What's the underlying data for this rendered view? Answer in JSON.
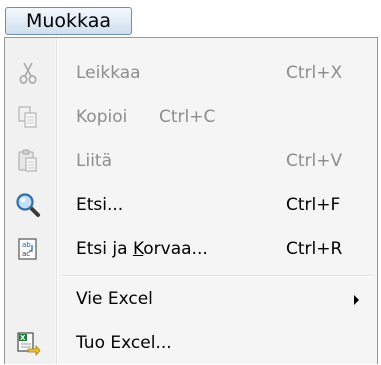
{
  "menu": {
    "title": "Muokkaa",
    "items": [
      {
        "label": "Leikkaa",
        "shortcut": "Ctrl+X",
        "enabled": false,
        "icon": "scissors-icon"
      },
      {
        "label": "Kopioi",
        "shortcut": "Ctrl+C",
        "enabled": false,
        "icon": "copy-icon"
      },
      {
        "label": "Liitä",
        "shortcut": "Ctrl+V",
        "enabled": false,
        "icon": "paste-icon"
      },
      {
        "label": "Etsi...",
        "shortcut": "Ctrl+F",
        "enabled": true,
        "icon": "magnifier-icon"
      },
      {
        "label_pre": "Etsi ja ",
        "label_underlined": "K",
        "label_post": "orvaa...",
        "shortcut": "Ctrl+R",
        "enabled": true,
        "icon": "replace-icon"
      },
      {
        "label": "Vie Excel",
        "has_submenu": true,
        "enabled": true,
        "icon": "none"
      },
      {
        "label": "Tuo Excel...",
        "enabled": true,
        "icon": "excel-import-icon"
      }
    ]
  },
  "colors": {
    "disabled_text": "#8d8d8d",
    "menu_title_border": "#6f8fb2",
    "menu_background": "#f5f5f5"
  }
}
